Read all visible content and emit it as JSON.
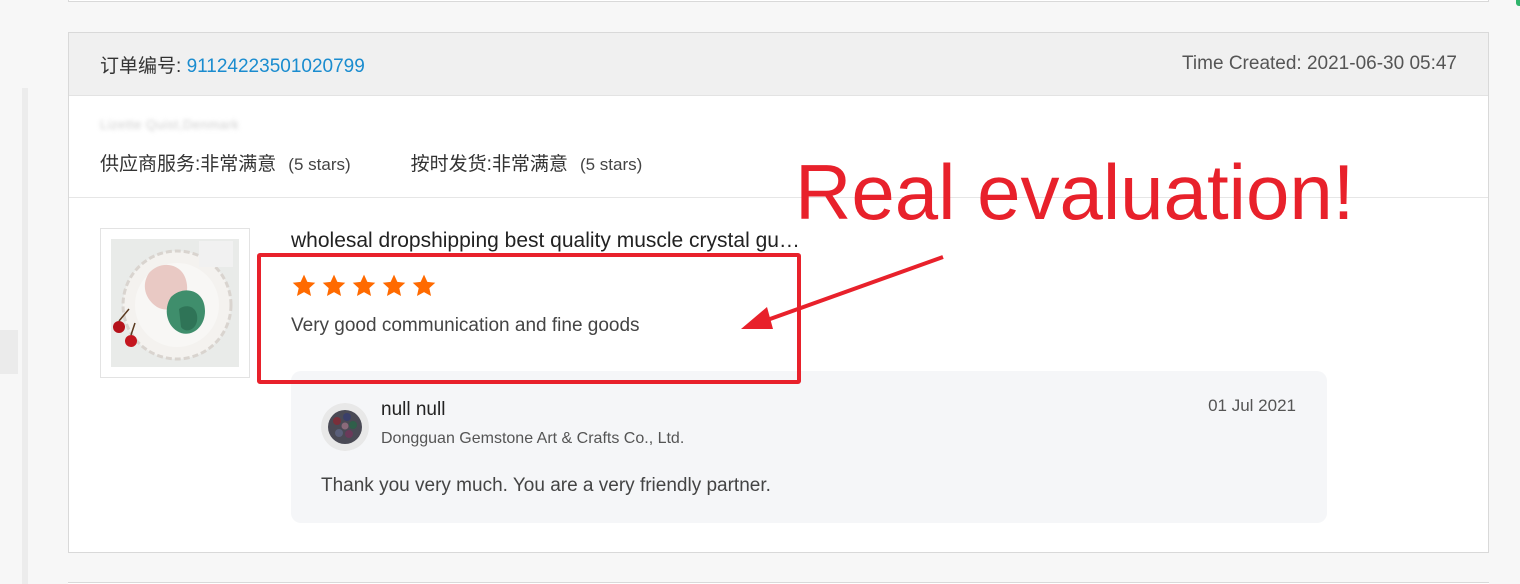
{
  "order": {
    "number_label": "订单编号:",
    "number": "91124223501020799",
    "time_created_label": "Time Created:",
    "time_created": "2021-06-30 05:47"
  },
  "buyer": {
    "blurred_name": "Lizette Quist,Denmark"
  },
  "ratings": [
    {
      "label": "供应商服务:",
      "value": "非常满意",
      "stars_note": "(5 stars)"
    },
    {
      "label": "按时发货:",
      "value": "非常满意",
      "stars_note": "(5 stars)"
    }
  ],
  "product": {
    "title": "wholesal dropshipping best quality muscle crystal gua sha board",
    "rating_stars": 5,
    "review": "Very good communication and fine goods"
  },
  "annotation": {
    "text": "Real evaluation!",
    "color": "#e8212b"
  },
  "reply": {
    "name": "null null",
    "company": "Dongguan Gemstone Art & Crafts Co., Ltd.",
    "date": "01 Jul 2021",
    "text": "Thank you very much. You are a very friendly partner."
  },
  "colors": {
    "link": "#1a8ccf",
    "star": "#ff6a00",
    "header_bg": "#f0f0f0",
    "reply_bg": "#f5f6f8"
  }
}
